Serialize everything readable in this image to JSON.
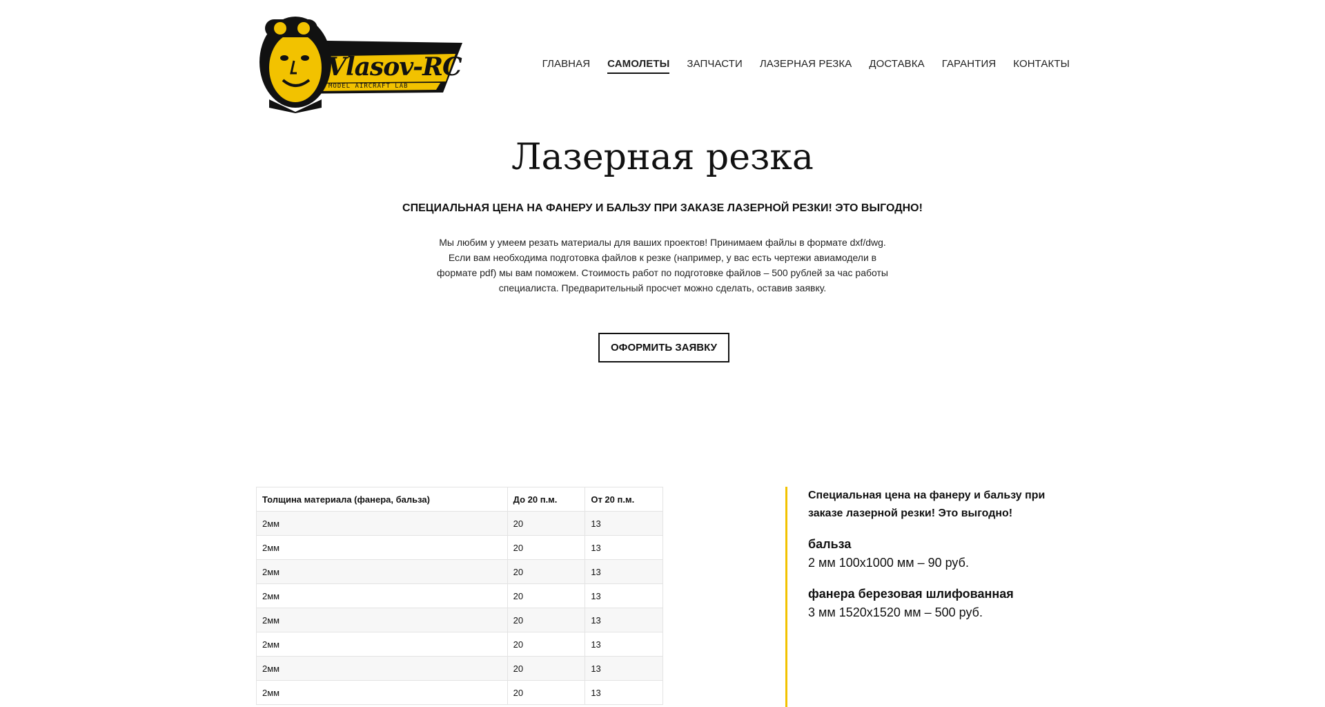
{
  "brand": {
    "logo_text": "Vlasov-RC",
    "logo_tagline": "MODEL AIRCRAFT LAB",
    "colors": {
      "accent": "#f2c200",
      "logo_dark": "#111111"
    }
  },
  "nav": {
    "items": [
      {
        "label": "ГЛАВНАЯ",
        "active": false
      },
      {
        "label": "САМОЛЕТЫ",
        "active": true
      },
      {
        "label": "ЗАПЧАСТИ",
        "active": false
      },
      {
        "label": "ЛАЗЕРНАЯ РЕЗКА",
        "active": false
      },
      {
        "label": "ДОСТАВКА",
        "active": false
      },
      {
        "label": "ГАРАНТИЯ",
        "active": false
      },
      {
        "label": "КОНТАКТЫ",
        "active": false
      }
    ]
  },
  "hero": {
    "title": "Лазерная резка",
    "subtitle": "СПЕЦИАЛЬНАЯ ЦЕНА НА ФАНЕРУ И БАЛЬЗУ ПРИ ЗАКАЗЕ ЛАЗЕРНОЙ РЕЗКИ! ЭТО ВЫГОДНО!",
    "text": "Мы любим у умеем резать материалы для ваших проектов! Принимаем файлы в формате dxf/dwg. Если вам необходима подготовка файлов к резке (например, у вас есть чертежи авиамодели в формате pdf) мы вам поможем. Стоимость работ по подготовке файлов – 500 рублей за час работы специалиста. Предварительный просчет можно сделать, оставив заявку.",
    "cta_label": "ОФОРМИТЬ ЗАЯВКУ"
  },
  "price_table": {
    "headers": [
      "Толщина материала (фанера, бальза)",
      "До 20 п.м.",
      "От 20 п.м."
    ],
    "rows": [
      [
        "2мм",
        "20",
        "13"
      ],
      [
        "2мм",
        "20",
        "13"
      ],
      [
        "2мм",
        "20",
        "13"
      ],
      [
        "2мм",
        "20",
        "13"
      ],
      [
        "2мм",
        "20",
        "13"
      ],
      [
        "2мм",
        "20",
        "13"
      ],
      [
        "2мм",
        "20",
        "13"
      ],
      [
        "2мм",
        "20",
        "13"
      ]
    ]
  },
  "side_info": {
    "heading": "Специальная цена на фанеру и бальзу при заказе лазерной резки! Это выгодно!",
    "items": [
      {
        "title": "бальза",
        "text": "2 мм 100х1000 мм – 90 руб."
      },
      {
        "title": "фанера березовая шлифованная",
        "text": "3 мм 1520х1520 мм – 500 руб."
      }
    ]
  }
}
